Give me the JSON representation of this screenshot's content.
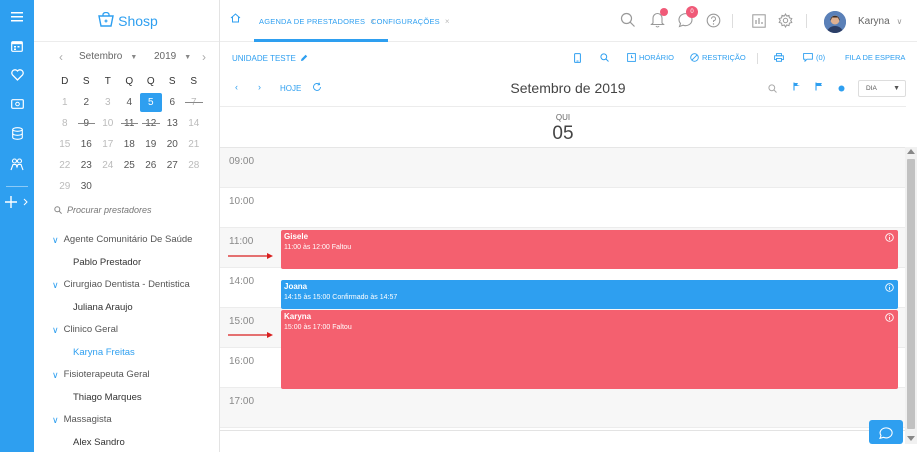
{
  "colors": {
    "accent": "#2e9ff0",
    "event_missed": "#f4606f",
    "event_confirmed": "#2e9ff0",
    "badge": "#f05a78"
  },
  "brand": {
    "name": "Shosp"
  },
  "calendar": {
    "month": "Setembro",
    "year": "2019",
    "weekdays": [
      "D",
      "S",
      "T",
      "Q",
      "Q",
      "S",
      "S"
    ],
    "weeks": [
      [
        "1",
        "2",
        "3",
        "4",
        "5",
        "6",
        "7"
      ],
      [
        "8",
        "9",
        "10",
        "11",
        "12",
        "13",
        "14"
      ],
      [
        "15",
        "16",
        "17",
        "18",
        "19",
        "20",
        "21"
      ],
      [
        "22",
        "23",
        "24",
        "25",
        "26",
        "27",
        "28"
      ],
      [
        "29",
        "30",
        "",
        "",
        "",
        "",
        ""
      ]
    ]
  },
  "search": {
    "placeholder": "Procurar prestadores"
  },
  "providers": [
    {
      "group": "Agente Comunitário De Saúde",
      "name": "Pablo Prestador"
    },
    {
      "group": "Cirurgiao Dentista - Dentistica",
      "name": "Juliana Araujo"
    },
    {
      "group": "Clinico Geral",
      "name": "Karyna Freitas"
    },
    {
      "group": "Fisioterapeuta Geral",
      "name": "Thiago Marques"
    },
    {
      "group": "Massagista",
      "name": "Alex Sandro"
    }
  ],
  "tabs": [
    {
      "label": "AGENDA DE PRESTADORES"
    },
    {
      "label": "CONFIGURAÇÕES"
    }
  ],
  "header": {
    "username": "Karyna",
    "messages_badge": "0"
  },
  "toolbar": {
    "unit": "UNIDADE TESTE",
    "horario": "HORÁRIO",
    "restricao": "RESTRIÇÃO",
    "count": "(0)",
    "waitlist": "FILA DE ESPERA"
  },
  "nav": {
    "today": "HOJE",
    "title": "Setembro de 2019",
    "view_select": "DIA"
  },
  "day": {
    "weekday": "QUI",
    "number": "05"
  },
  "times": [
    "09:00",
    "10:00",
    "11:00",
    "14:00",
    "15:00",
    "16:00",
    "17:00"
  ],
  "events": [
    {
      "name": "Gisele",
      "detail": "11:00 às 12:00 Faltou",
      "status": "missed"
    },
    {
      "name": "Joana",
      "detail": "14:15 às 15:00 Confirmado às 14:57",
      "status": "confirmed"
    },
    {
      "name": "Karyna",
      "detail": "15:00 às 17:00 Faltou",
      "status": "missed"
    }
  ]
}
